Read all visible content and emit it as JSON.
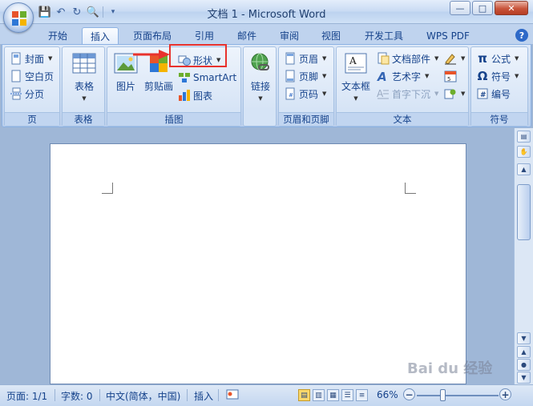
{
  "window": {
    "title": "文档 1 - Microsoft Word"
  },
  "tabs": [
    {
      "label": "开始"
    },
    {
      "label": "插入"
    },
    {
      "label": "页面布局"
    },
    {
      "label": "引用"
    },
    {
      "label": "邮件"
    },
    {
      "label": "审阅"
    },
    {
      "label": "视图"
    },
    {
      "label": "开发工具"
    },
    {
      "label": "WPS PDF"
    }
  ],
  "ribbon": {
    "pages": {
      "label": "页",
      "cover": "封面",
      "blank": "空白页",
      "break": "分页"
    },
    "tables": {
      "label": "表格",
      "table": "表格"
    },
    "illustrations": {
      "label": "插图",
      "picture": "图片",
      "clipart": "剪贴画",
      "shapes": "形状",
      "smartart": "SmartArt",
      "chart": "图表"
    },
    "links": {
      "label": "链接"
    },
    "header_footer": {
      "label": "页眉和页脚",
      "header": "页眉",
      "footer": "页脚",
      "page_number": "页码"
    },
    "text": {
      "label": "文本",
      "textbox": "文本框",
      "quickparts": "文档部件",
      "wordart": "艺术字",
      "dropcap": "首字下沉"
    },
    "symbols": {
      "label": "符号",
      "equation": "公式",
      "symbol": "符号",
      "numbering": "编号"
    }
  },
  "status": {
    "page": "页面: 1/1",
    "words": "字数: 0",
    "language": "中文(简体，中国)",
    "mode": "插入",
    "zoom": "66%"
  },
  "watermark": "Bai du 经验",
  "colors": {
    "annotation": "#e8322d",
    "ribbon_text": "#15428b"
  }
}
